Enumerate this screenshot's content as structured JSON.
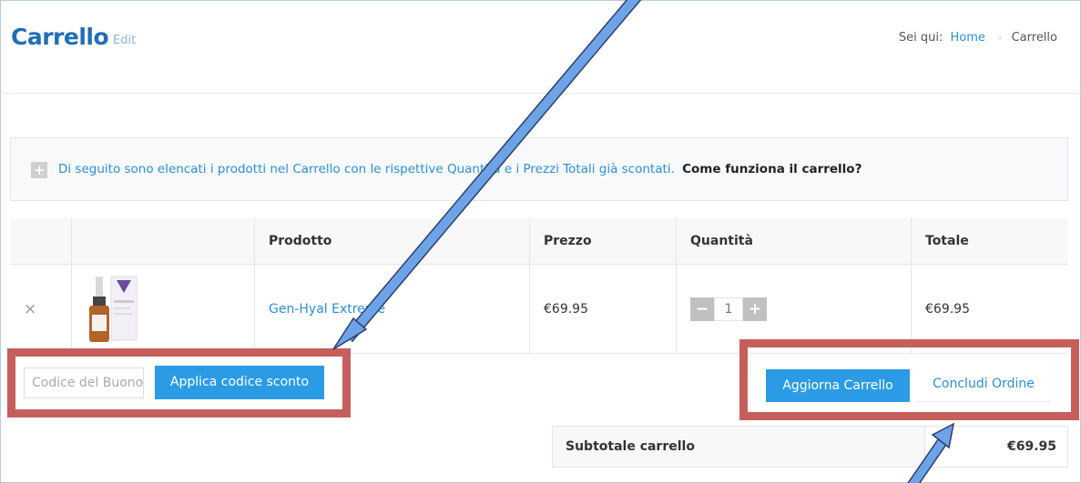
{
  "header": {
    "title": "Carrello",
    "edit_label": "Edit",
    "breadcrumb": {
      "prefix": "Sei qui:",
      "home": "Home",
      "current": "Carrello"
    }
  },
  "info": {
    "text": "Di seguito sono elencati i prodotti nel Carrello con le rispettive Quantità e i Prezzi Totali già scontati.",
    "link": "Come funziona il carrello?"
  },
  "table": {
    "headers": [
      "",
      "",
      "Prodotto",
      "Prezzo",
      "Quantità",
      "Totale"
    ],
    "rows": [
      {
        "remove_icon": "×",
        "product": "Gen-Hyal Extreme",
        "price": "€69.95",
        "quantity": "1",
        "total": "€69.95"
      }
    ]
  },
  "coupon": {
    "placeholder": "Codice del Buono",
    "apply_label": "Applica codice sconto"
  },
  "actions": {
    "update_label": "Aggiorna Carrello",
    "checkout_label": "Concludi Ordine"
  },
  "subtotal": {
    "label": "Subtotale carrello",
    "value": "€69.95"
  },
  "icons": {
    "info": "plus-icon",
    "remove": "remove-icon",
    "minus": "minus-icon",
    "plus": "plus-icon"
  },
  "colors": {
    "accent": "#2b9be6",
    "title": "#1f6fb5",
    "highlight": "#c65f5c",
    "arrow": "#6fa3e8"
  }
}
